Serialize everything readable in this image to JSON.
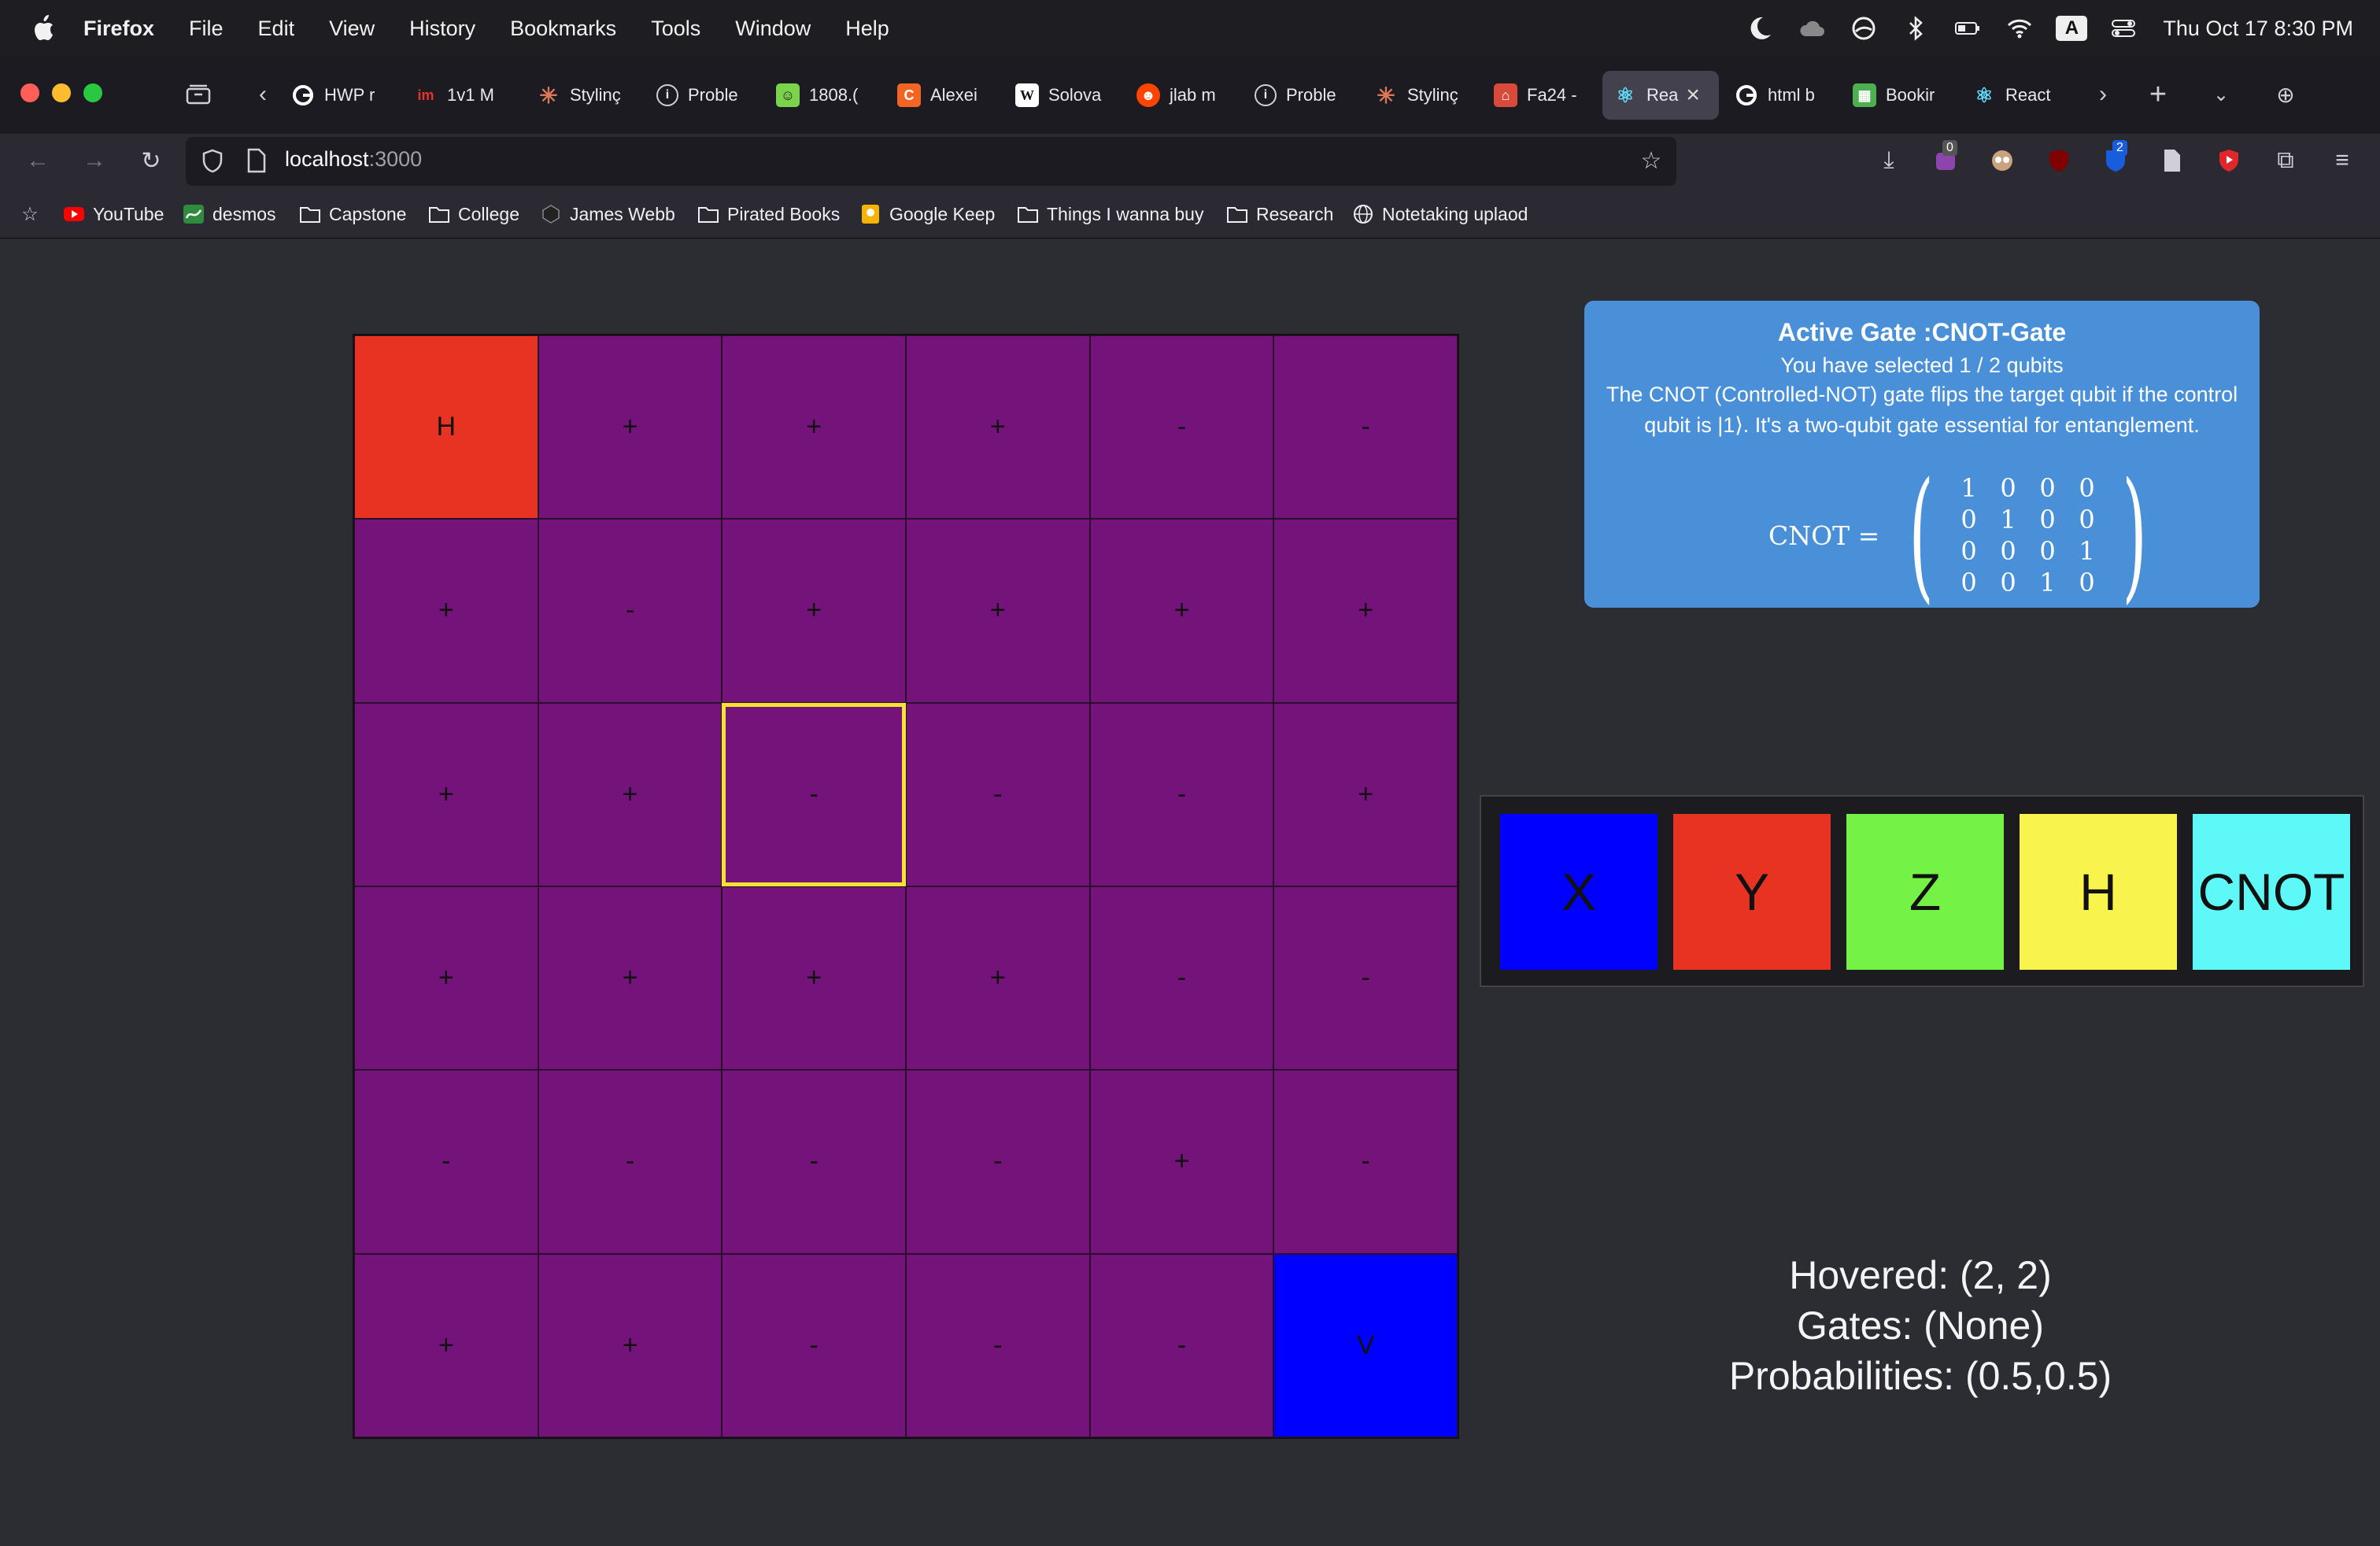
{
  "menubar": {
    "app": "Firefox",
    "items": [
      "File",
      "Edit",
      "View",
      "History",
      "Bookmarks",
      "Tools",
      "Window",
      "Help"
    ],
    "clock": "Thu Oct 17  8:30 PM",
    "input_indicator": "A"
  },
  "tabs": [
    {
      "label": "HWP r",
      "icon": "google-icon",
      "color": "#ffffff"
    },
    {
      "label": "1v1 M",
      "icon": "im-icon",
      "color": "#e8322b"
    },
    {
      "label": "Stylinç",
      "icon": "claude-icon",
      "color": "#d97757"
    },
    {
      "label": "Proble",
      "icon": "info-icon",
      "color": "#cfcfd8"
    },
    {
      "label": "1808.(",
      "icon": "smiley-icon",
      "color": "#7bd34c"
    },
    {
      "label": "Alexei",
      "icon": "c-icon",
      "color": "#f26522"
    },
    {
      "label": "Solova",
      "icon": "wikipedia-icon",
      "color": "#ffffff"
    },
    {
      "label": "jlab m",
      "icon": "reddit-icon",
      "color": "#ff4500"
    },
    {
      "label": "Proble",
      "icon": "info-icon",
      "color": "#cfcfd8"
    },
    {
      "label": "Stylinç",
      "icon": "claude-icon",
      "color": "#d97757"
    },
    {
      "label": "Fa24 -",
      "icon": "app-icon",
      "color": "#d84a3a"
    },
    {
      "label": "Rea",
      "icon": "react-icon",
      "color": "#61dafb",
      "active": true
    },
    {
      "label": "html b",
      "icon": "google-icon",
      "color": "#ffffff"
    },
    {
      "label": "Bookir",
      "icon": "sheets-icon",
      "color": "#4caf50"
    },
    {
      "label": "React",
      "icon": "react-icon",
      "color": "#61dafb"
    }
  ],
  "url": {
    "host": "localhost",
    "port": ":3000"
  },
  "badges": {
    "extension_a": "0",
    "extension_b": "2"
  },
  "bookmarks": [
    {
      "label": "YouTube",
      "icon": "youtube-icon"
    },
    {
      "label": "desmos",
      "icon": "desmos-icon"
    },
    {
      "label": "Capstone",
      "icon": "folder-icon"
    },
    {
      "label": "College",
      "icon": "folder-icon"
    },
    {
      "label": "James Webb",
      "icon": "hexagon-icon"
    },
    {
      "label": "Pirated Books",
      "icon": "folder-icon"
    },
    {
      "label": "Google Keep",
      "icon": "keep-icon"
    },
    {
      "label": "Things I wanna buy",
      "icon": "folder-icon"
    },
    {
      "label": "Research",
      "icon": "folder-icon"
    },
    {
      "label": "Notetaking uplaod",
      "icon": "globe-icon"
    }
  ],
  "grid": {
    "rows": [
      [
        "H",
        "+",
        "+",
        "+",
        "-",
        "-"
      ],
      [
        "+",
        "-",
        "+",
        "+",
        "+",
        "+"
      ],
      [
        "+",
        "+",
        "-",
        "-",
        "-",
        "+"
      ],
      [
        "+",
        "+",
        "+",
        "+",
        "-",
        "-"
      ],
      [
        "-",
        "-",
        "-",
        "-",
        "+",
        "-"
      ],
      [
        "+",
        "+",
        "-",
        "-",
        "-",
        "V"
      ]
    ],
    "hovered": [
      2,
      2
    ],
    "colors": {
      "cell": "#74137a",
      "start": "#e83323",
      "goal": "#0000ff",
      "hover_border": "#f5e332"
    }
  },
  "info": {
    "title": "Active Gate :CNOT-Gate",
    "selected": "You have selected 1 / 2 qubits",
    "description": "The CNOT (Controlled-NOT) gate flips the target qubit if the control qubit is |1⟩. It's a two-qubit gate essential for entanglement.",
    "matrix_label": "CNOT =",
    "matrix": [
      [
        "1",
        "0",
        "0",
        "0"
      ],
      [
        "0",
        "1",
        "0",
        "0"
      ],
      [
        "0",
        "0",
        "0",
        "1"
      ],
      [
        "0",
        "0",
        "1",
        "0"
      ]
    ]
  },
  "gates": [
    {
      "label": "X",
      "color": "#0000ff"
    },
    {
      "label": "Y",
      "color": "#e83323"
    },
    {
      "label": "Z",
      "color": "#74f346"
    },
    {
      "label": "H",
      "color": "#f8f34d"
    },
    {
      "label": "CNOT",
      "color": "#5ef8f8"
    }
  ],
  "status": {
    "hovered": "Hovered: (2, 2)",
    "gates": "Gates: (None)",
    "probabilities": "Probabilities: (0.5,0.5)"
  }
}
